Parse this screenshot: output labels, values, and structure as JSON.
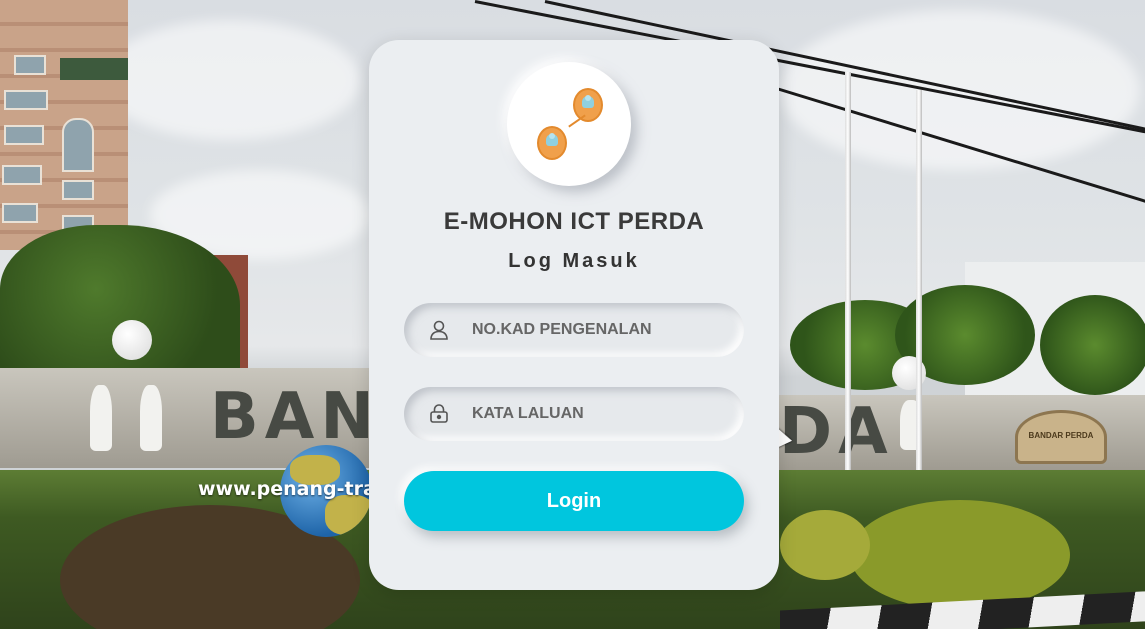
{
  "background": {
    "watermark": "www.penang-trav",
    "wall_text_left": "BAN",
    "wall_text_right": "DA",
    "sign_text": "BANDAR PERDA"
  },
  "login": {
    "app_title": "E-MOHON ICT PERDA",
    "subtitle": "Log Masuk",
    "ic_placeholder": "NO.KAD PENGENALAN",
    "password_placeholder": "KATA LALUAN",
    "submit_label": "Login",
    "accent_color": "#00c6de",
    "icons": {
      "logo": "chat-users-icon",
      "ic_field": "user-icon",
      "password_field": "lock-icon"
    }
  }
}
